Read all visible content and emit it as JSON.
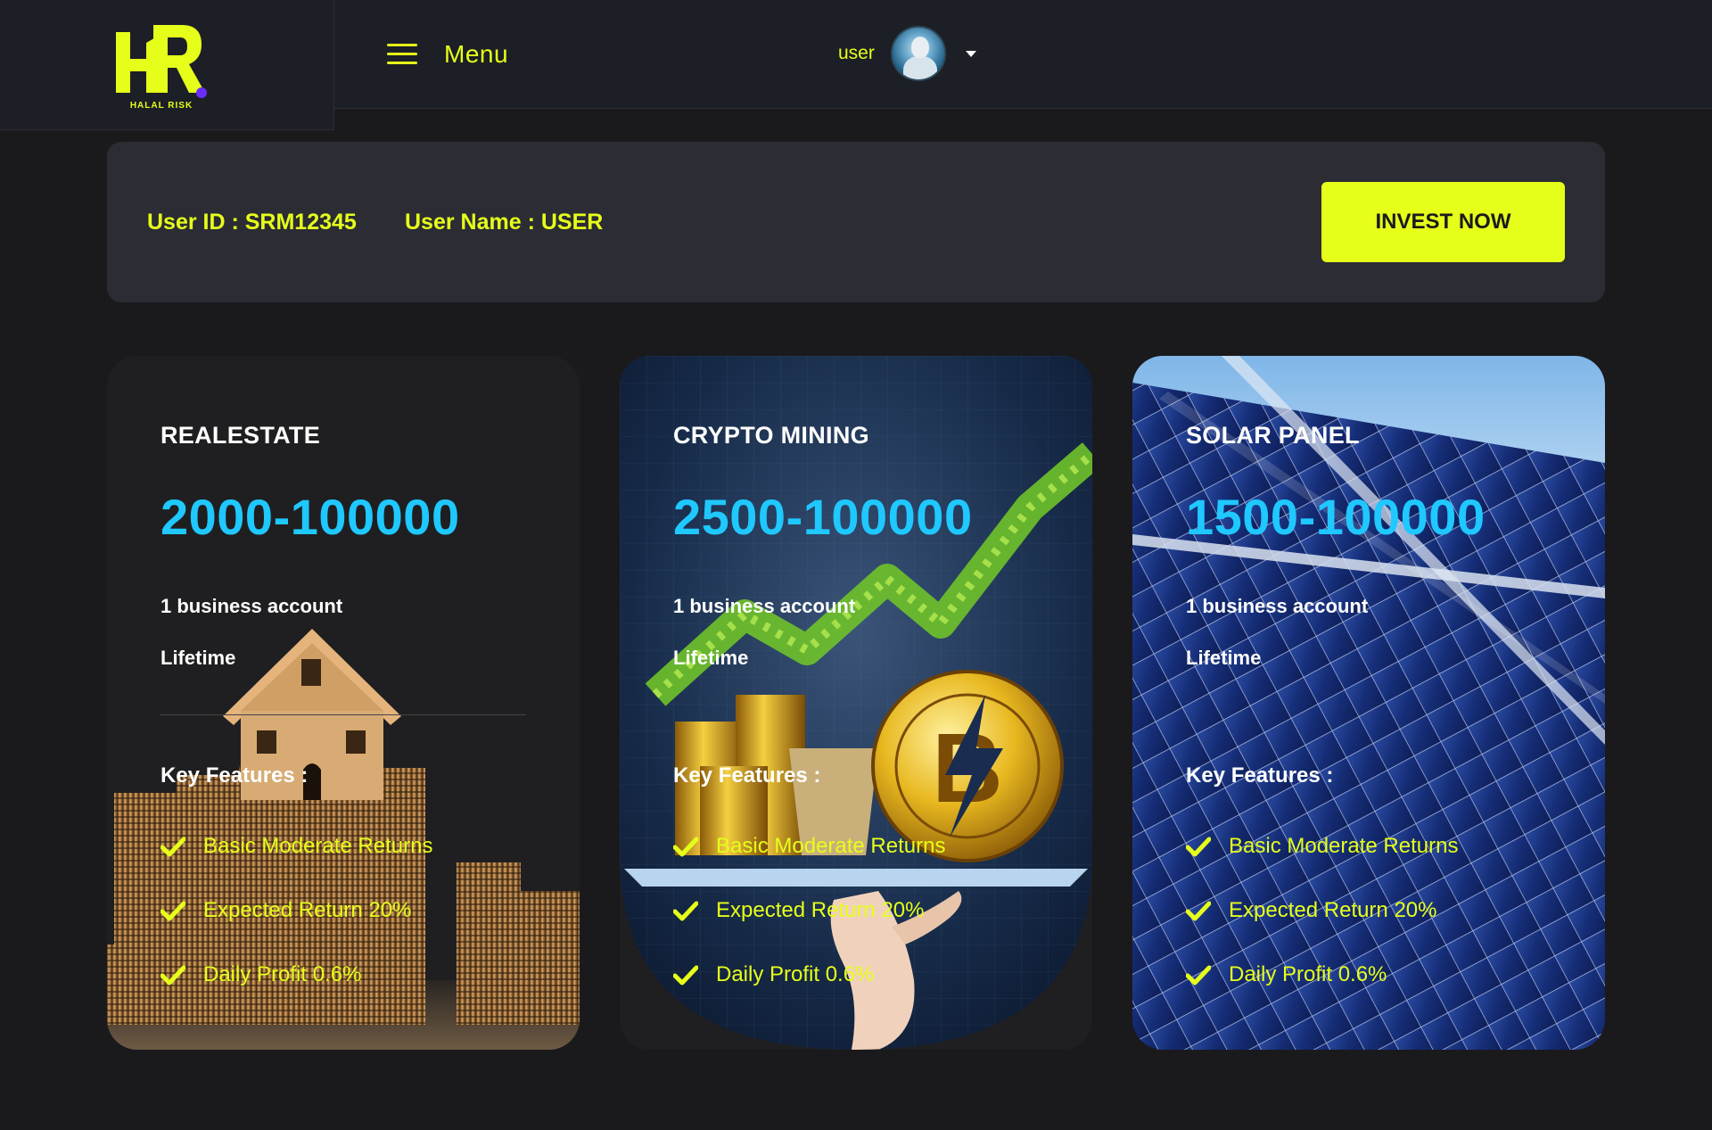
{
  "header": {
    "logo": {
      "letters": "HR",
      "tagline": "HALAL RISK"
    },
    "menu_label": "Menu",
    "user_label": "user",
    "avatar_icon": "user-avatar"
  },
  "account": {
    "user_id": "User ID : SRM12345",
    "user_name": "User Name : USER",
    "invest_button": "INVEST NOW"
  },
  "colors": {
    "accent": "#e6ff1a",
    "price": "#1fc8ff",
    "panel": "#2b2c34",
    "background": "#1a1a1c"
  },
  "plans": [
    {
      "title": "REALESTATE",
      "range": "2000-100000",
      "account": "1 business account",
      "duration": "Lifetime",
      "features_heading": "Key Features :",
      "features": [
        "Basic Moderate Returns",
        "Expected Return 20%",
        "Daily Profit 0.6%"
      ],
      "background_image": "house-on-coin-stacks"
    },
    {
      "title": "CRYPTO MINING",
      "range": "2500-100000",
      "account": "1 business account",
      "duration": "Lifetime",
      "features_heading": "Key Features :",
      "features": [
        "Basic Moderate Returns",
        "Expected Return 20%",
        "Daily Profit 0.6%"
      ],
      "background_image": "bitcoin-coins-plant-growth-chart"
    },
    {
      "title": "SOLAR PANEL",
      "range": "1500-100000",
      "account": "1 business account",
      "duration": "Lifetime",
      "features_heading": "Key Features :",
      "features": [
        "Basic Moderate Returns",
        "Expected Return 20%",
        "Daily Profit 0.6%"
      ],
      "background_image": "solar-panels-blue-sky"
    }
  ]
}
